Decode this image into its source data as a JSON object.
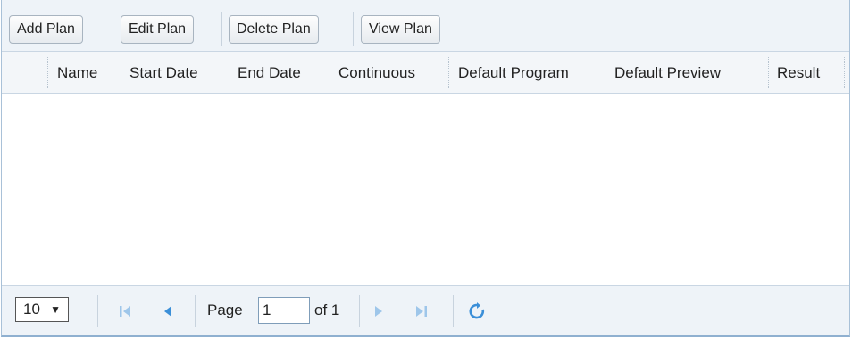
{
  "toolbar": {
    "buttons": [
      {
        "label": "Add Plan"
      },
      {
        "label": "Edit Plan"
      },
      {
        "label": "Delete Plan"
      },
      {
        "label": "View Plan"
      }
    ]
  },
  "table": {
    "columns": [
      "Name",
      "Start Date",
      "End Date",
      "Continuous",
      "Default Program",
      "Default Preview",
      "Result"
    ],
    "rows": []
  },
  "pager": {
    "page_size": "10",
    "page_label": "Page",
    "current_page": "1",
    "of_label": "of 1",
    "icons": [
      "first-page-icon",
      "prev-page-icon",
      "next-page-icon",
      "last-page-icon",
      "refresh-icon"
    ],
    "colors": {
      "nav_active": "#3b8fd8",
      "nav_disabled": "#9ec6ea"
    }
  }
}
